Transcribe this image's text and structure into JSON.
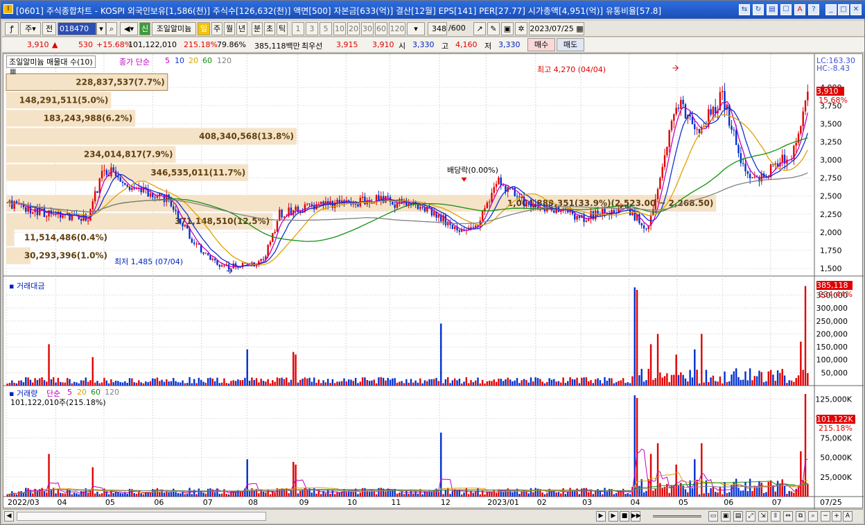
{
  "window": {
    "title": "[0601] 주식종합차트 - KOSPI 외국인보유[1,586(천)] 주식수[126,632(천)] 액면[500] 자본금[633(억)] 결산[12월] EPS[141] PER[27.77] 시가총액[4,951(억)] 유통비율[57.8]"
  },
  "toolbar": {
    "mode": "주",
    "prev": "전",
    "code": "018470",
    "stock_name": "조일알미늄",
    "periods": [
      "일",
      "주",
      "월",
      "년",
      "분",
      "초",
      "틱"
    ],
    "intervals": [
      "1",
      "3",
      "5",
      "10",
      "20",
      "30",
      "60",
      "120"
    ],
    "count": "348",
    "max": "/600",
    "date": "2023/07/25",
    "new_label": "신"
  },
  "quote": {
    "price": "3,910",
    "change": "530",
    "change_pct": "+15.68%",
    "volume": "101,122,010",
    "vol_ratio": "215.18%",
    "turnover": "79.86%",
    "amount": "385,118백만",
    "priority": "최우선",
    "ask": "3,915",
    "bid": "3,910",
    "open_label": "시",
    "open": "3,330",
    "high_label": "고",
    "high": "4,160",
    "low_label": "저",
    "low": "3,330",
    "buy": "매수",
    "sell": "매도"
  },
  "price_panel": {
    "legend_name": "조일알미늄 매물대 수(10)",
    "ma_label": "종가 단순",
    "ma_periods": [
      "5",
      "10",
      "20",
      "60",
      "120"
    ],
    "ma_colors": [
      "#c000c0",
      "#1030d0",
      "#e0a000",
      "#109010",
      "#808080"
    ],
    "lc": "LC:163.30",
    "hc": "HC:-8.43",
    "price_tag": "3,910",
    "pct_tag": "15.68%",
    "high_note": "최고 4,270 (04/04)",
    "low_note": "최저 1,485 (07/04)",
    "dividend_note": "배당락(0.00%)",
    "volume_profile": [
      {
        "label": "228,837,537(7.7%)",
        "price": 4075,
        "frac": 0.2
      },
      {
        "label": "148,291,511(5.0%)",
        "price": 3825,
        "frac": 0.13
      },
      {
        "label": "183,243,988(6.2%)",
        "price": 3575,
        "frac": 0.16
      },
      {
        "label": "408,340,568(13.8%)",
        "price": 3325,
        "frac": 0.36
      },
      {
        "label": "234,014,817(7.9%)",
        "price": 3075,
        "frac": 0.21
      },
      {
        "label": "346,535,011(11.7%)",
        "price": 2825,
        "frac": 0.3
      },
      {
        "label": "1,004,889,351(33.9%)(2,523.00 ~ 2,268.50)",
        "price": 2400,
        "frac": 0.88
      },
      {
        "label": "371,148,510(12.5%)",
        "price": 2150,
        "frac": 0.33
      },
      {
        "label": "11,514,486(0.4%)",
        "price": 1925,
        "frac": 0.01
      },
      {
        "label": "30,293,396(1.0%)",
        "price": 1675,
        "frac": 0.03
      }
    ],
    "yticks": [
      "4,000",
      "3,750",
      "3,500",
      "3,250",
      "3,000",
      "2,750",
      "2,500",
      "2,250",
      "2,000",
      "1,750",
      "1,500"
    ]
  },
  "amount_panel": {
    "title": "거래대금",
    "tag": "385,118",
    "pct": "234.44%",
    "yticks": [
      "350,000",
      "300,000",
      "250,000",
      "200,000",
      "150,000",
      "100,000",
      "50,000"
    ]
  },
  "volume_panel": {
    "title": "거래량",
    "ma_label": "단순",
    "ma_periods": [
      "5",
      "20",
      "60",
      "120"
    ],
    "value_line": "101,122,010주(215.18%)",
    "tag": "101,122K",
    "pct": "215.18%",
    "yticks": [
      "125,000K",
      "100,000K",
      "75,000K",
      "50,000K",
      "25,000K"
    ]
  },
  "xaxis": {
    "labels": [
      "2022/03",
      "04",
      "05",
      "06",
      "07",
      "08",
      "09",
      "10",
      "11",
      "12",
      "2023/01",
      "02",
      "03",
      "04",
      "05",
      "06",
      "07"
    ],
    "right_label": "07/25"
  }
}
